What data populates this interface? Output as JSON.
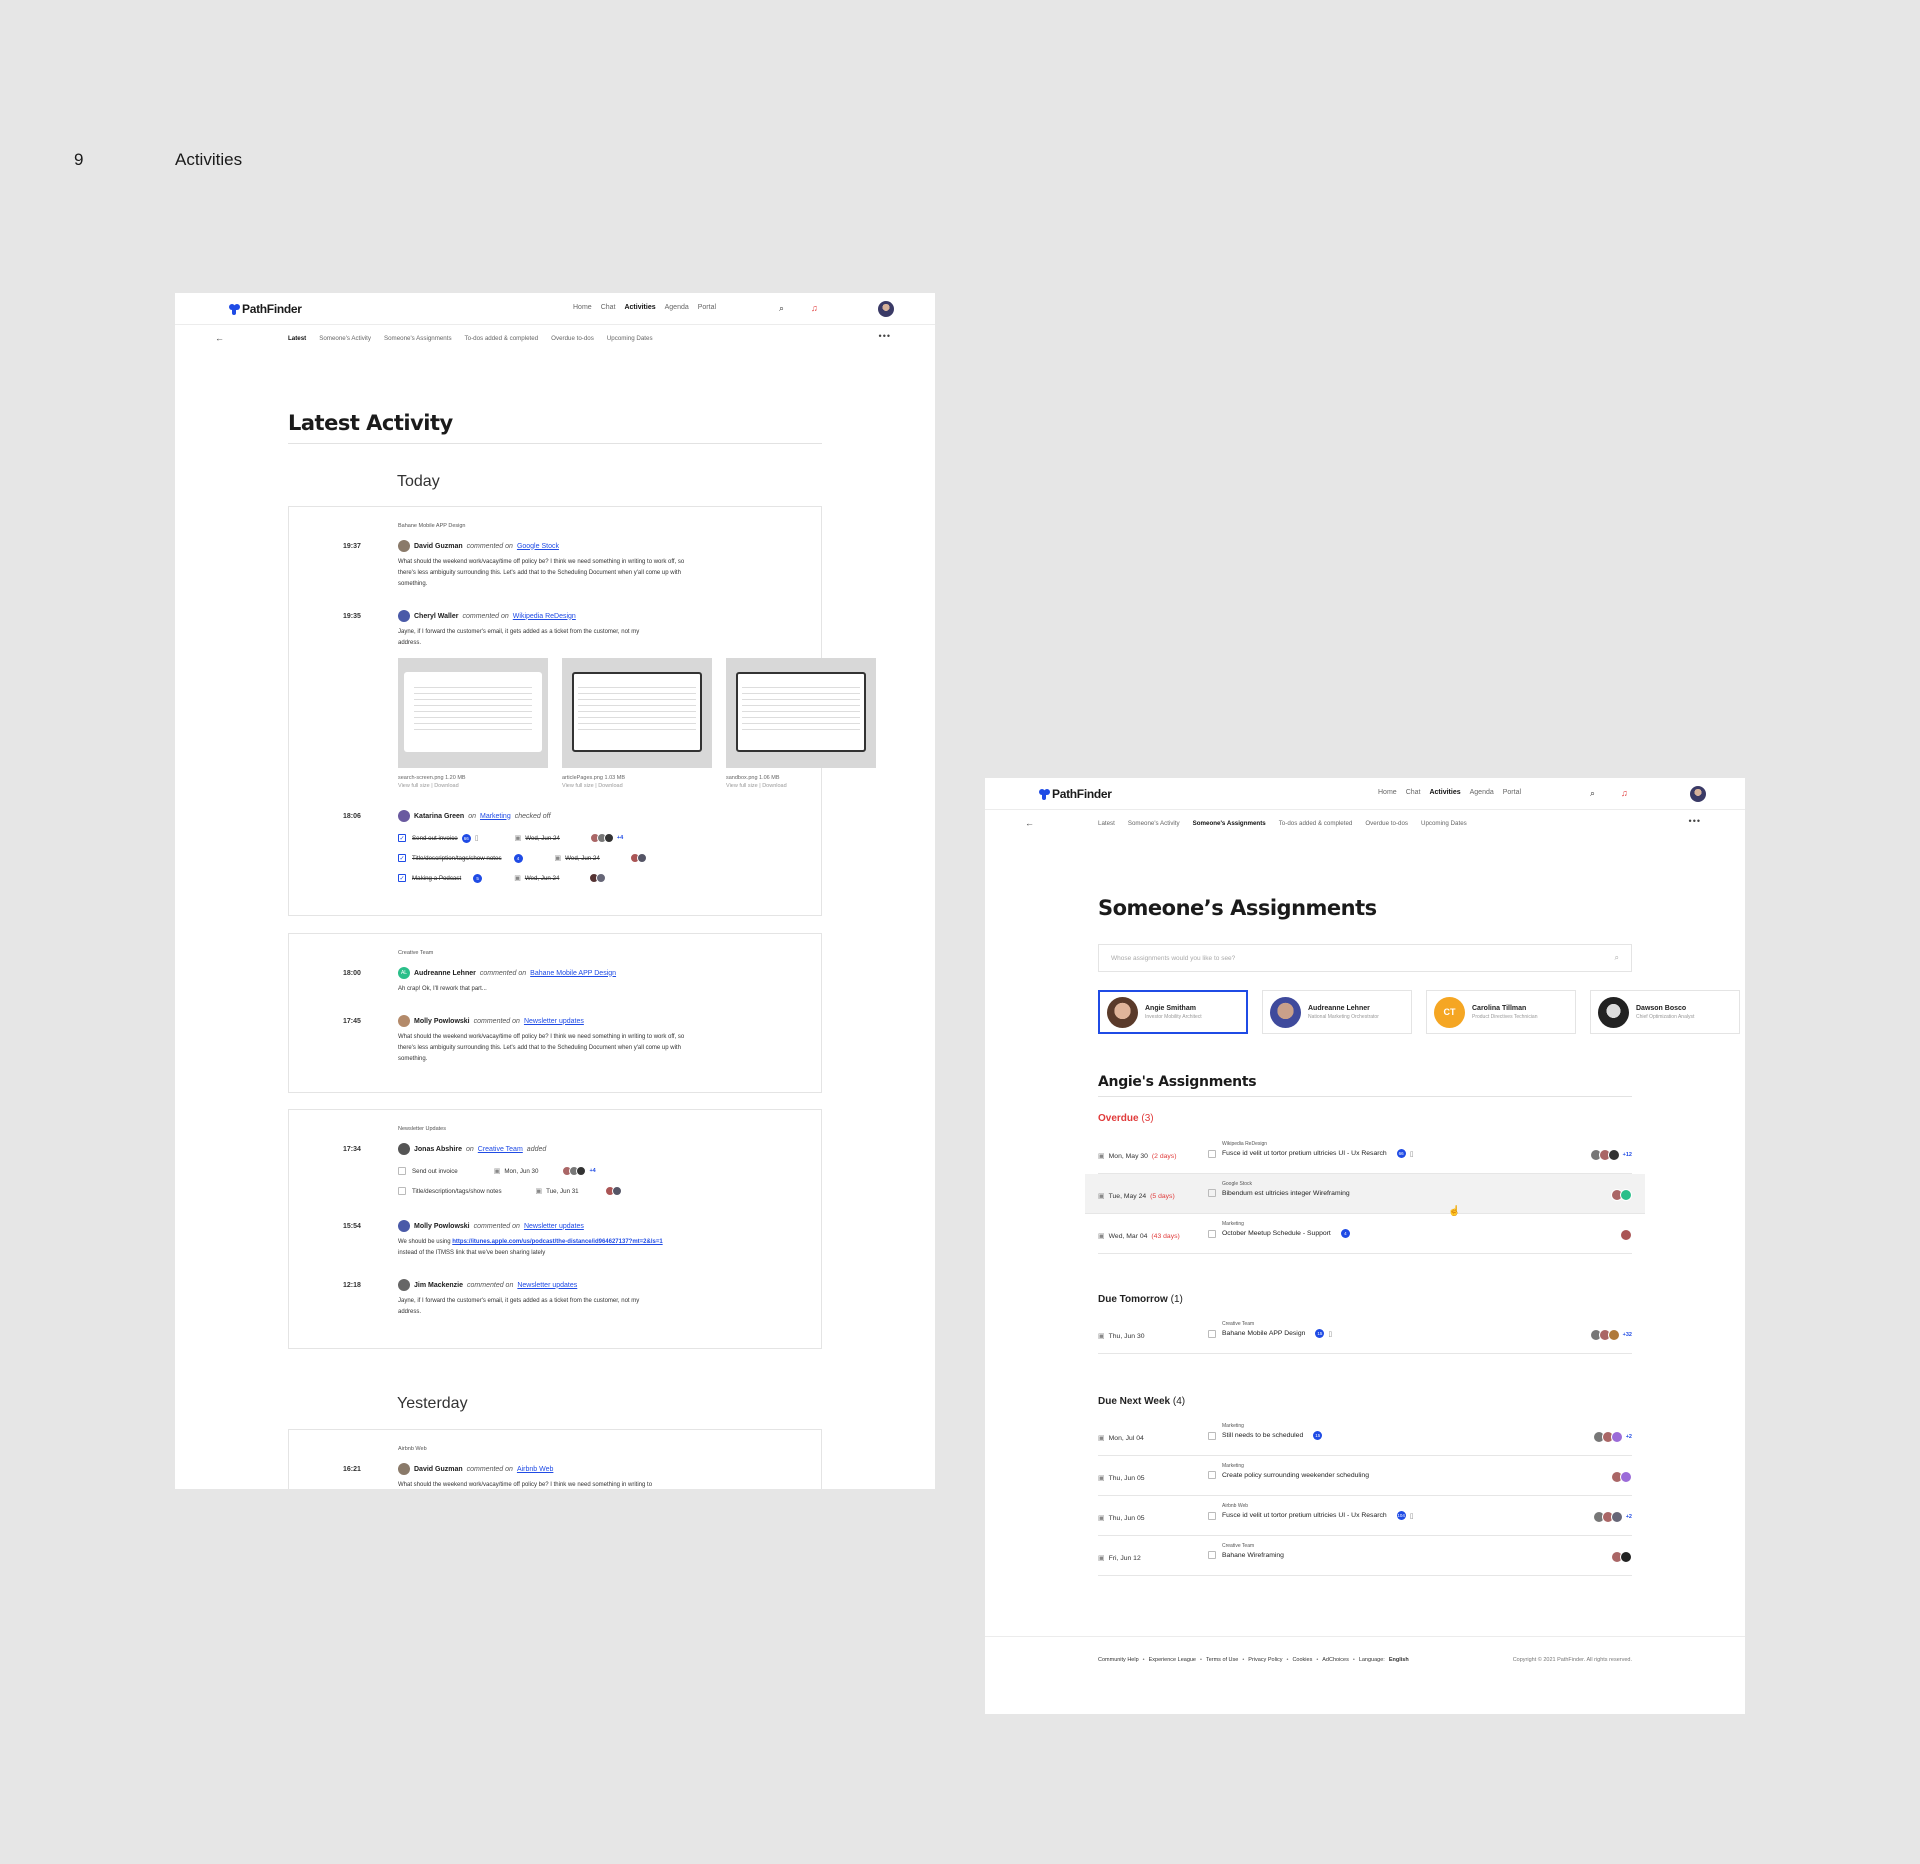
{
  "slide": {
    "number": "9",
    "title": "Activities"
  },
  "brand": {
    "name": "PathFinder",
    "accent": "#1f4be5",
    "alert": "#e03a3a"
  },
  "mainnav": [
    "Home",
    "Chat",
    "Activities",
    "Agenda",
    "Portal"
  ],
  "subtabs": [
    "Latest",
    "Someone's Activity",
    "Someone's Assignments",
    "To-dos added & completed",
    "Overdue to-dos",
    "Upcoming Dates"
  ],
  "icons": {
    "back": "arrow-left-icon",
    "more": "more-horizontal-icon",
    "search": "search-icon",
    "bell": "bell-icon"
  },
  "latest": {
    "title": "Latest Activity",
    "today": "Today",
    "yesterday": "Yesterday",
    "card1": {
      "context": "Bahane Mobile APP Design",
      "e1": {
        "time": "19:37",
        "name": "David Guzman",
        "verb": "commented on",
        "link": "Google Stock",
        "body": "What should the weekend work/vacay/time off policy be? I think we need something in writing to work off, so there's less ambiguity surrounding this. Let's add that to the Scheduling Document when y'all come up with something."
      },
      "e2": {
        "time": "19:35",
        "name": "Cheryl Waller",
        "verb": "commented on",
        "link": "Wikipedia ReDesign",
        "body": "Jayne, if I forward the customer's email, it gets added as a ticket from the customer, not my address."
      },
      "files": [
        {
          "name": "search-screen.png",
          "size": "1.20 MB",
          "view": "View full size",
          "download": "Download"
        },
        {
          "name": "articlePages.png",
          "size": "1.03 MB",
          "view": "View full size",
          "download": "Download"
        },
        {
          "name": "sandbox.png",
          "size": "1.06 MB",
          "view": "View full size",
          "download": "Download"
        }
      ],
      "e3": {
        "time": "18:06",
        "name": "Katarina Green",
        "on": "on",
        "link": "Marketing",
        "verb": "checked off"
      },
      "tasks": [
        {
          "label": "Send out invoice",
          "chip": "66",
          "date": "Wed, Jun 24",
          "more": "+4"
        },
        {
          "label": "Title/description/tags/show notes",
          "chip": "4",
          "date": "Wed, Jun 24"
        },
        {
          "label": "Making a Podcast",
          "chip": "5",
          "date": "Wed, Jun 24"
        }
      ]
    },
    "card2": {
      "context": "Creative Team",
      "e1": {
        "time": "18:00",
        "initials": "AL",
        "name": "Audreanne Lehner",
        "verb": "commented on",
        "link": "Bahane Mobile APP Design",
        "body": "Ah crap! Ok, I'll rework that part..."
      },
      "e2": {
        "time": "17:45",
        "name": "Molly Powlowski",
        "verb": "commented on",
        "link": "Newsletter updates",
        "body": "What should the weekend work/vacay/time off policy be? I think we need something in writing to work off, so there's less ambiguity surrounding this. Let's add that to the Scheduling Document when y'all come up with something."
      }
    },
    "card3": {
      "context": "Newsletter Updates",
      "e1": {
        "time": "17:34",
        "name": "Jonas Abshire",
        "on": "on",
        "link": "Creative Team",
        "verb": "added"
      },
      "tasks": [
        {
          "label": "Send out invoice",
          "date": "Mon, Jun 30",
          "more": "+4"
        },
        {
          "label": "Title/description/tags/show notes",
          "date": "Tue, Jun 31"
        }
      ],
      "e2": {
        "time": "15:54",
        "name": "Molly Powlowski",
        "verb": "commented on",
        "link": "Newsletter updates",
        "pre": "We should be using ",
        "url": "https://itunes.apple.com/us/podcast/the-distance/id964627137?mt=2&ls=1",
        "post": "instead of the ITMSS link that we've been sharing lately"
      },
      "e3": {
        "time": "12:18",
        "name": "Jim Mackenzie",
        "verb": "commented on",
        "link": "Newsletter updates",
        "body": "Jayne, if I forward the customer's email, it gets added as a ticket from the customer, not my address."
      }
    },
    "card4": {
      "context": "Airbnb Web",
      "e1": {
        "time": "16:21",
        "name": "David Guzman",
        "verb": "commented on",
        "link": "Airbnb Web",
        "body": "What should the weekend work/vacay/time off policy be? I think we need something in writing to"
      }
    }
  },
  "assign": {
    "title": "Someone’s Assignments",
    "search_placeholder": "Whose assignments would you like to see?",
    "people": [
      {
        "name": "Angie Smitham",
        "role": "Investor Mobility Architect"
      },
      {
        "name": "Audreanne Lehner",
        "role": "National Marketing Orchestrator"
      },
      {
        "initials": "CT",
        "name": "Carolina Tillman",
        "role": "Product Directives Technician"
      },
      {
        "name": "Dawson Bosco",
        "role": "Chief Optimization Analyst"
      }
    ],
    "subtitle": "Angie's Assignments",
    "overdue": {
      "label": "Overdue",
      "count": "(3)"
    },
    "tomorrow": {
      "label": "Due Tomorrow",
      "count": "(1)"
    },
    "nextweek": {
      "label": "Due Next Week",
      "count": "(4)"
    },
    "rows_overdue": [
      {
        "date": "Mon, May 30",
        "late": "(2 days)",
        "ctx": "Wikipedia ReDesign",
        "task": "Fusce id velit ut tortor pretium ultricies UI - Ux Resarch",
        "chip": "66",
        "more": "+12"
      },
      {
        "date": "Tue, May 24",
        "late": "(5 days)",
        "ctx": "Google Stock",
        "task": "Bibendum est ultricies integer Wireframing"
      },
      {
        "date": "Wed, Mar 04",
        "late": "(43 days)",
        "ctx": "Marketing",
        "task": "October Meetup Schedule - Support",
        "chip": "4"
      }
    ],
    "rows_tomorrow": [
      {
        "date": "Thu, Jun 30",
        "ctx": "Creative Team",
        "task": "Bahane Mobile APP Design",
        "chip": "15",
        "more": "+32"
      }
    ],
    "rows_week": [
      {
        "date": "Mon, Jul 04",
        "ctx": "Marketing",
        "task": "Still needs to be scheduled",
        "chip": "15",
        "more": "+2"
      },
      {
        "date": "Thu, Jun 05",
        "ctx": "Marketing",
        "task": "Create policy surrounding weekender scheduling"
      },
      {
        "date": "Thu, Jun 05",
        "ctx": "Airbnb Web",
        "task": "Fusce id velit ut tortor pretium ultricies UI - Ux Resarch",
        "chip": "104",
        "more": "+2"
      },
      {
        "date": "Fri, Jun 12",
        "ctx": "Creative Team",
        "task": "Bahane Wireframing"
      }
    ],
    "footer": {
      "links": [
        "Community Help",
        "Experience League",
        "Terms of Use",
        "Privacy Policy",
        "Cookies",
        "AdChoices"
      ],
      "language_label": "Language:",
      "language": "English",
      "copyright": "Copyright © 2021 PathFinder. All rights reserved."
    }
  }
}
